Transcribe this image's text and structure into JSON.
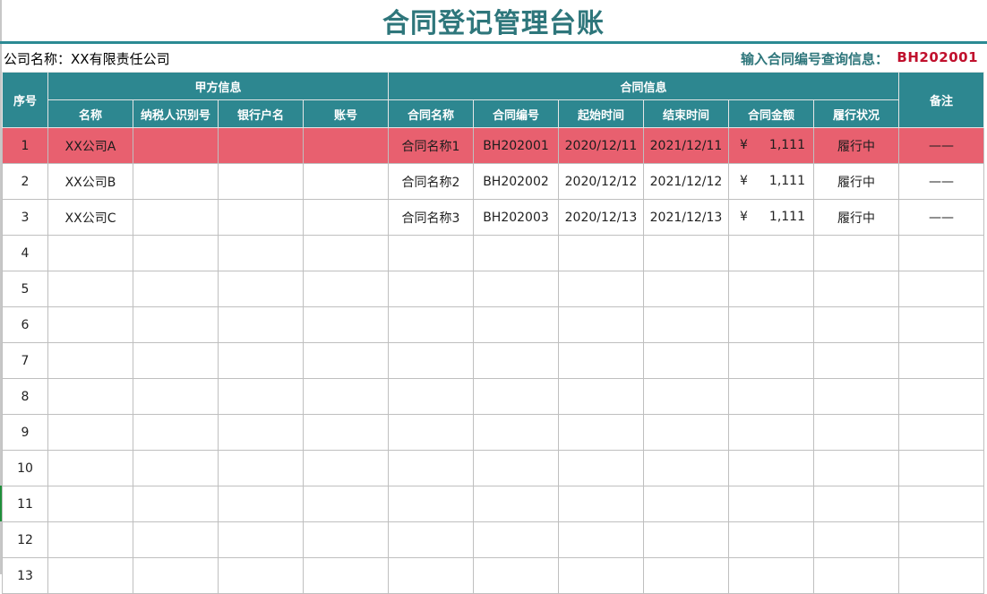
{
  "title": "合同登记管理台账",
  "company": {
    "label": "公司名称：",
    "value": "XX有限责任公司"
  },
  "query": {
    "label": "输入合同编号查询信息：",
    "value": "BH202001"
  },
  "colors": {
    "header_bg": "#2d8790",
    "title": "#2e767b",
    "highlight_row": "#e8606f",
    "query_value": "#c0102d"
  },
  "header": {
    "seq": "序号",
    "party_a": "甲方信息",
    "contract": "合同信息",
    "remarks": "备注",
    "cols": [
      "名称",
      "纳税人识别号",
      "银行户名",
      "账号",
      "合同名称",
      "合同编号",
      "起始时间",
      "结束时间",
      "合同金额",
      "履行状况"
    ]
  },
  "rows": [
    {
      "seq": "1",
      "name": "XX公司A",
      "tax_id": "",
      "bank_name": "",
      "account": "",
      "contract_name": "合同名称1",
      "contract_no": "BH202001",
      "start": "2020/12/11",
      "end": "2021/12/11",
      "currency": "¥",
      "amount": "1,111",
      "status": "履行中",
      "remark": "——"
    },
    {
      "seq": "2",
      "name": "XX公司B",
      "tax_id": "",
      "bank_name": "",
      "account": "",
      "contract_name": "合同名称2",
      "contract_no": "BH202002",
      "start": "2020/12/12",
      "end": "2021/12/12",
      "currency": "¥",
      "amount": "1,111",
      "status": "履行中",
      "remark": "——"
    },
    {
      "seq": "3",
      "name": "XX公司C",
      "tax_id": "",
      "bank_name": "",
      "account": "",
      "contract_name": "合同名称3",
      "contract_no": "BH202003",
      "start": "2020/12/13",
      "end": "2021/12/13",
      "currency": "¥",
      "amount": "1,111",
      "status": "履行中",
      "remark": "——"
    },
    {
      "seq": "4"
    },
    {
      "seq": "5"
    },
    {
      "seq": "6"
    },
    {
      "seq": "7"
    },
    {
      "seq": "8"
    },
    {
      "seq": "9"
    },
    {
      "seq": "10"
    },
    {
      "seq": "11"
    },
    {
      "seq": "12"
    },
    {
      "seq": "13"
    }
  ]
}
